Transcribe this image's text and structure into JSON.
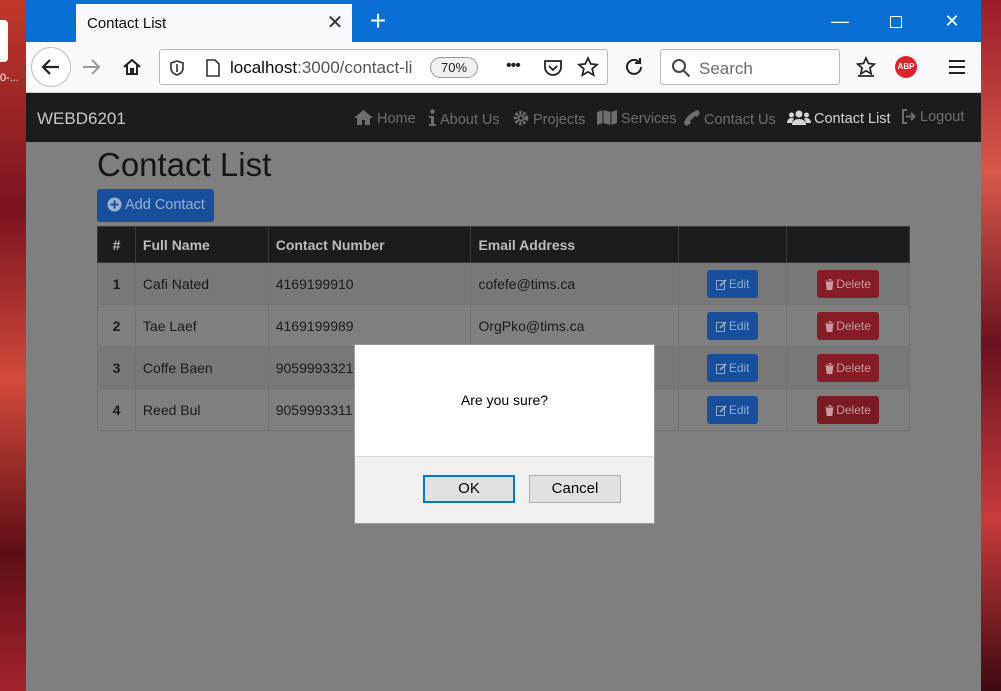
{
  "desktop": {
    "icon_label": "0-..."
  },
  "browser": {
    "tab_title": "Contact List",
    "url_host": "localhost",
    "url_rest": ":3000/contact-li",
    "zoom": "70%",
    "search_placeholder": "Search",
    "abp_label": "ABP",
    "menu_dots": "•••"
  },
  "navbar": {
    "brand": "WEBD6201",
    "items": [
      {
        "label": "Home",
        "icon": "home-icon"
      },
      {
        "label": "About Us",
        "icon": "info-icon"
      },
      {
        "label": "Projects",
        "icon": "gear-icon"
      },
      {
        "label": "Services",
        "icon": "map-icon"
      },
      {
        "label": "Contact Us",
        "icon": "phone-icon"
      },
      {
        "label": "Contact List",
        "icon": "users-icon",
        "active": true
      },
      {
        "label": "Logout",
        "icon": "logout-icon"
      }
    ]
  },
  "main": {
    "title": "Contact List",
    "add_button": "Add Contact",
    "table": {
      "headers": [
        "#",
        "Full Name",
        "Contact Number",
        "Email Address",
        "",
        ""
      ],
      "rows": [
        {
          "num": "1",
          "name": "Cafi Nated",
          "phone": "4169199910",
          "email": "cofefe@tims.ca"
        },
        {
          "num": "2",
          "name": "Tae Laef",
          "phone": "4169199989",
          "email": "OrgPko@tims.ca"
        },
        {
          "num": "3",
          "name": "Coffe Baen",
          "phone": "9059993321",
          "email": ""
        },
        {
          "num": "4",
          "name": "Reed Bul",
          "phone": "9059993311",
          "email": ""
        }
      ],
      "edit_label": "Edit",
      "delete_label": "Delete"
    }
  },
  "dialog": {
    "message": "Are you sure?",
    "ok": "OK",
    "cancel": "Cancel"
  },
  "colors": {
    "titlebar": "#0a6fd4",
    "navbar": "#1b1c1e",
    "primary_button": "#174f9c",
    "danger_button": "#861c26"
  }
}
